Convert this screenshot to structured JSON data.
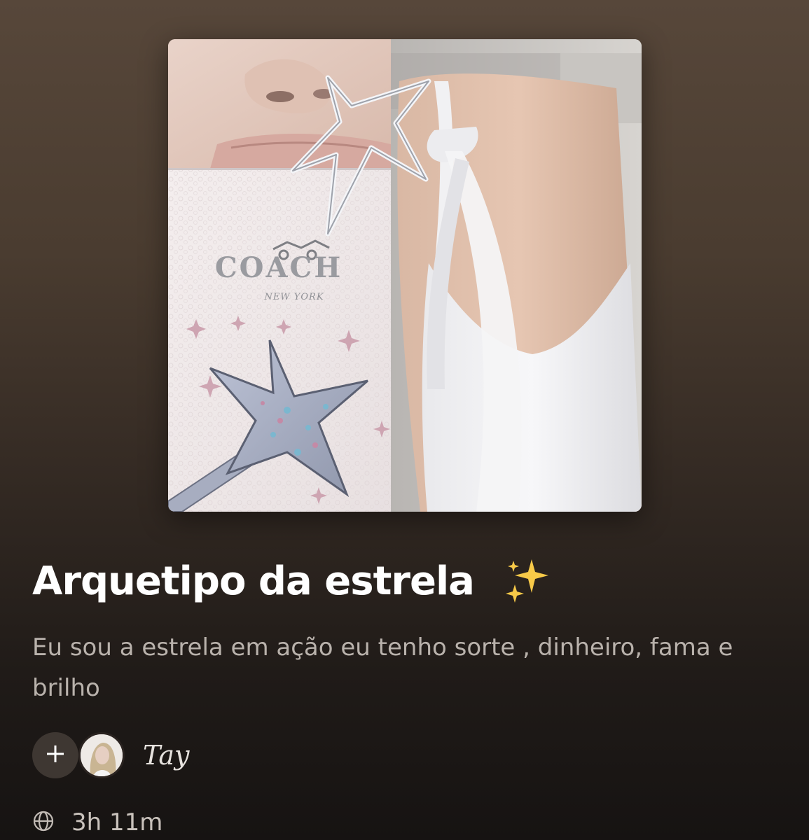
{
  "playlist": {
    "title": "Arquetipo da estrela",
    "title_emoji": "sparkles-icon",
    "description": "Eu sou a estrela em ação eu tenho sorte , dinheiro, fama e brilho",
    "cover_alt": "Playlist cover collage",
    "cover_brand_text": "COACH",
    "cover_brand_subtext": "NEW YORK",
    "owner": {
      "name": "Tay"
    },
    "duration": "3h 11m"
  },
  "icons": {
    "add": "plus-icon",
    "visibility": "globe-icon"
  },
  "colors": {
    "background_top": "#57473a",
    "background_bottom": "#161312",
    "title": "#ffffff",
    "description": "#b9b2ac"
  }
}
